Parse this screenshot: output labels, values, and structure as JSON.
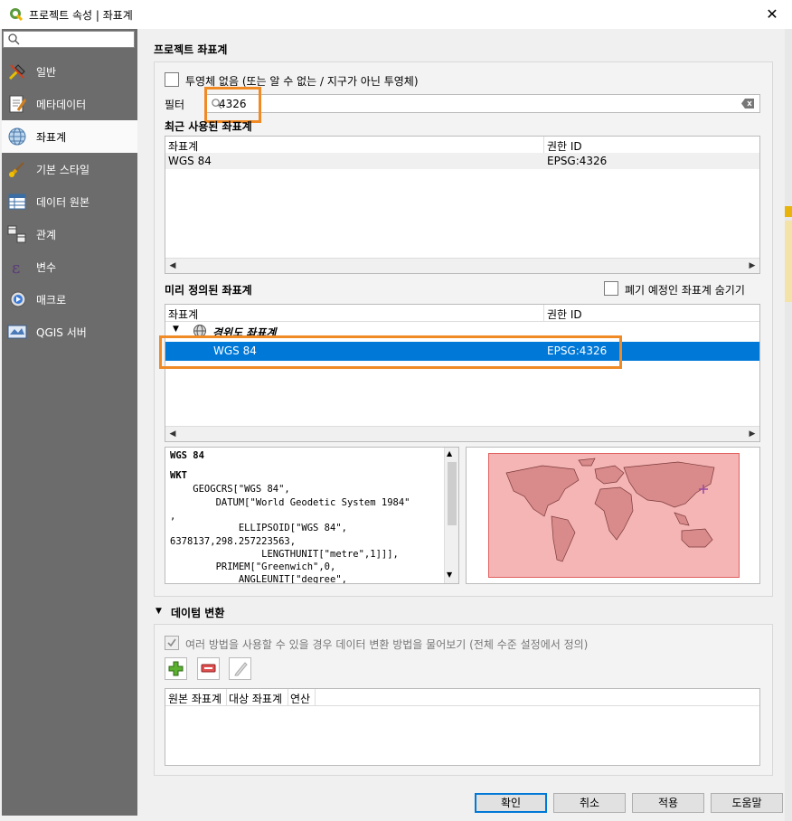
{
  "window": {
    "title": "프로젝트 속성 | 좌표계",
    "close_glyph": "✕"
  },
  "sidebar": {
    "search_placeholder": "",
    "items": [
      {
        "label": "일반",
        "icon": "wrench-icon"
      },
      {
        "label": "메타데이터",
        "icon": "metadata-icon"
      },
      {
        "label": "좌표계",
        "icon": "globe-icon",
        "active": true
      },
      {
        "label": "기본 스타일",
        "icon": "brush-icon"
      },
      {
        "label": "데이터 원본",
        "icon": "table-icon"
      },
      {
        "label": "관계",
        "icon": "relations-icon"
      },
      {
        "label": "변수",
        "icon": "epsilon-icon"
      },
      {
        "label": "매크로",
        "icon": "gear-play-icon"
      },
      {
        "label": "QGIS 서버",
        "icon": "server-icon"
      }
    ]
  },
  "project_crs": {
    "section_title": "프로젝트 좌표계",
    "no_projection_label": "투영체 없음 (또는 알 수 없는 / 지구가 아닌 투영체)",
    "filter_label": "필터",
    "filter_value": "4326"
  },
  "recent_crs": {
    "section_title": "최근 사용된 좌표계",
    "columns": [
      "좌표계",
      "권한 ID"
    ],
    "rows": [
      {
        "name": "WGS 84",
        "auth_id": "EPSG:4326"
      }
    ]
  },
  "predefined_crs": {
    "section_title": "미리 정의된 좌표계",
    "hide_deprecated_label": "폐기 예정인 좌표계 숨기기",
    "columns": [
      "좌표계",
      "권한 ID"
    ],
    "group_label": "경위도 좌표계",
    "selected_row": {
      "name": "WGS 84",
      "auth_id": "EPSG:4326"
    }
  },
  "crs_details": {
    "name": "WGS 84",
    "wkt_heading": "WKT",
    "wkt_lines": [
      "    GEOGCRS[\"WGS 84\",",
      "        DATUM[\"World Geodetic System 1984\"",
      ",",
      "            ELLIPSOID[\"WGS 84\",",
      "6378137,298.257223563,",
      "                LENGTHUNIT[\"metre\",1]]],",
      "        PRIMEM[\"Greenwich\",0,",
      "            ANGLEUNIT[\"degree\","
    ]
  },
  "datum_transform": {
    "section_title": "데이텀 변환",
    "ask_label": "여러 방법을 사용할 수 있을 경우 데이터 변환 방법을 물어보기 (전체 수준 설정에서 정의)",
    "columns": [
      "원본 좌표계",
      "대상 좌표계",
      "연산"
    ]
  },
  "buttons": {
    "ok": "확인",
    "cancel": "취소",
    "apply": "적용",
    "help": "도움말"
  },
  "colors": {
    "accent": "#0078d7",
    "highlight": "#f08a24",
    "sidebar": "#6c6c6c"
  }
}
